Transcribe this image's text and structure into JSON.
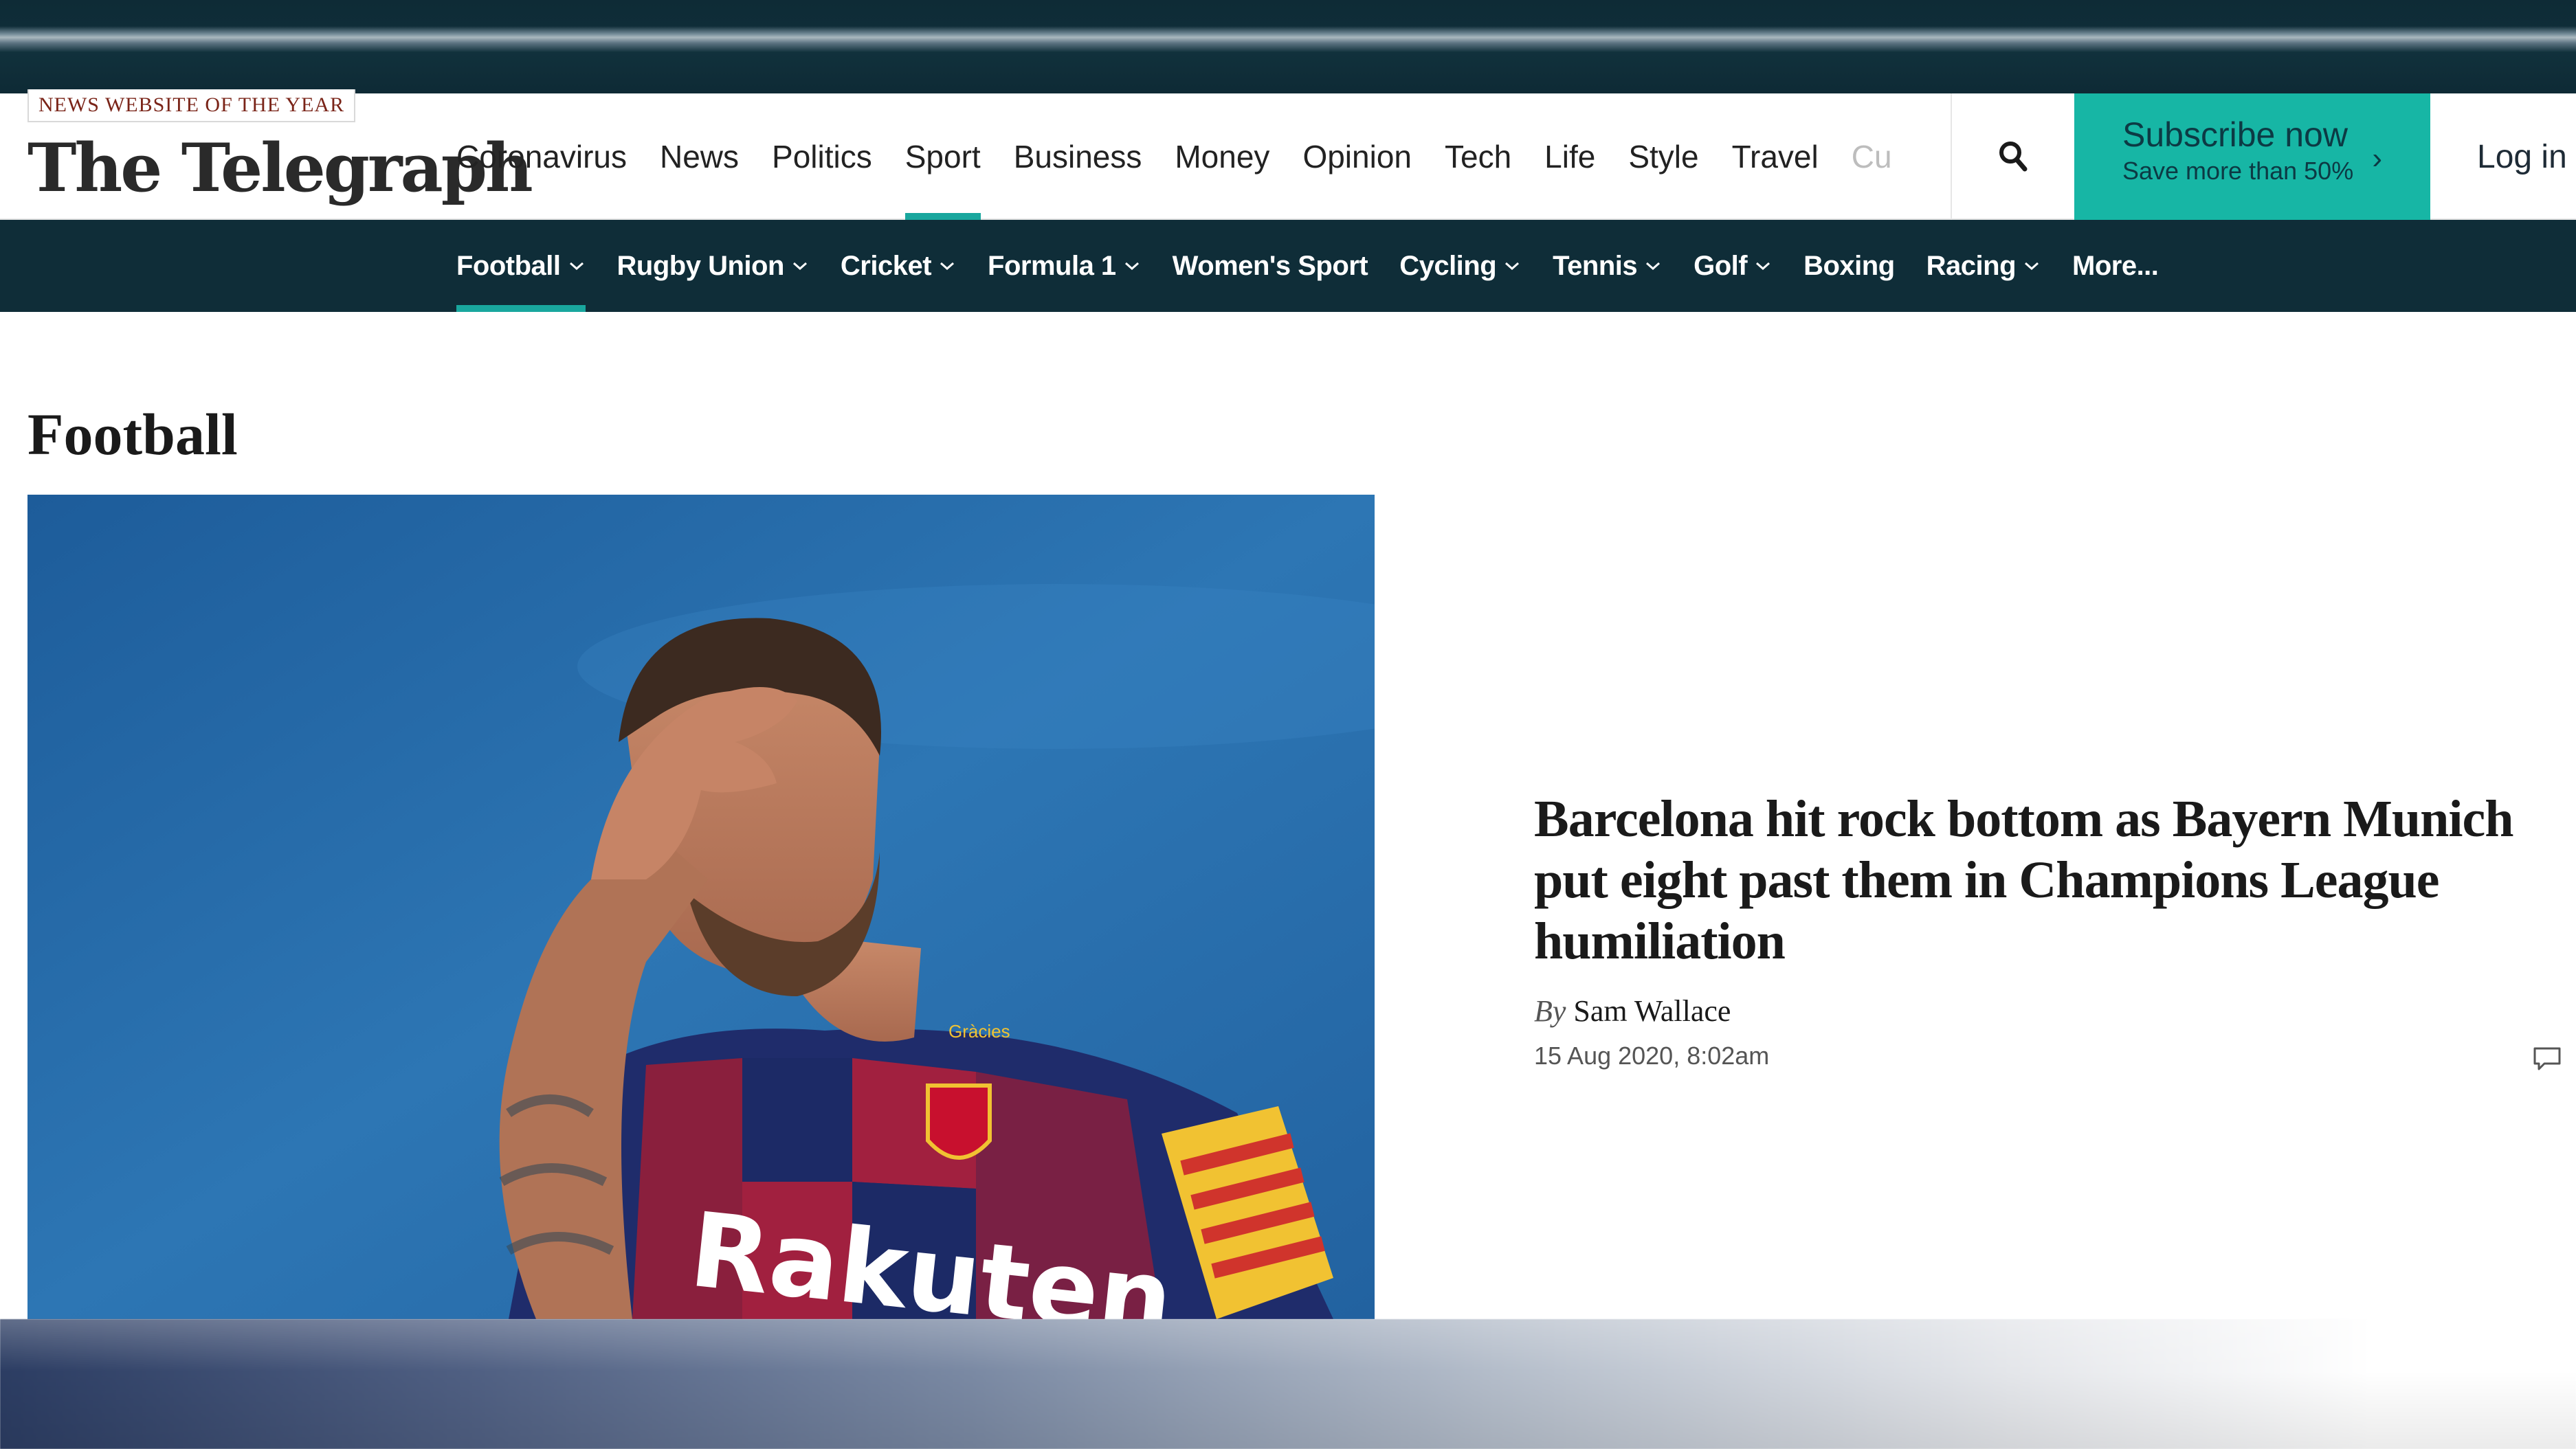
{
  "site": {
    "award": "NEWS WEBSITE OF THE YEAR",
    "logo": "The Telegraph"
  },
  "primary_nav": {
    "items": [
      {
        "label": "Coronavirus"
      },
      {
        "label": "News"
      },
      {
        "label": "Politics"
      },
      {
        "label": "Sport"
      },
      {
        "label": "Business"
      },
      {
        "label": "Money"
      },
      {
        "label": "Opinion"
      },
      {
        "label": "Tech"
      },
      {
        "label": "Life"
      },
      {
        "label": "Style"
      },
      {
        "label": "Travel"
      },
      {
        "label": "Cu"
      }
    ],
    "active": "Sport"
  },
  "header_actions": {
    "search_icon": "search-icon",
    "subscribe_title": "Subscribe now",
    "subscribe_sub": "Save more than 50%",
    "subscribe_chevron": "›",
    "login": "Log in"
  },
  "sport_nav": {
    "items": [
      {
        "label": "Football"
      },
      {
        "label": "Rugby Union"
      },
      {
        "label": "Cricket"
      },
      {
        "label": "Formula 1"
      },
      {
        "label": "Women's Sport"
      },
      {
        "label": "Cycling"
      },
      {
        "label": "Tennis"
      },
      {
        "label": "Golf"
      },
      {
        "label": "Boxing"
      },
      {
        "label": "Racing"
      },
      {
        "label": "More..."
      }
    ],
    "active": "Football"
  },
  "page": {
    "title": "Football"
  },
  "lead_story": {
    "headline": "Barcelona hit rock bottom as Bayern Munich put eight past them in Champions League humiliation",
    "by": "By",
    "author": "Sam Wallace",
    "date": "15 Aug 2020, 8:02am",
    "image": {
      "sponsor_text": "Rakuten",
      "shirt_text": "Gràcies"
    }
  },
  "colors": {
    "navy": "#0f2d38",
    "teal": "#17b6a5",
    "active_underline": "#19a79e",
    "headline": "#1a1a1a"
  }
}
